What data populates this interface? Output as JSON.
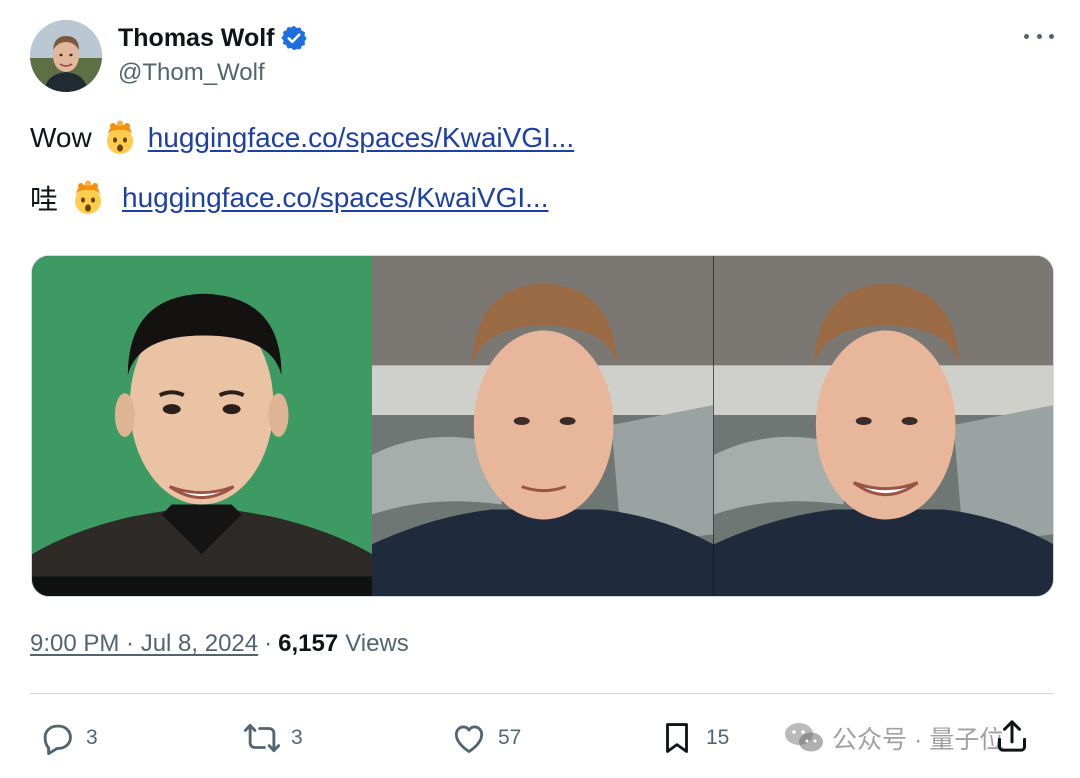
{
  "author": {
    "display_name": "Thomas Wolf",
    "handle": "@Thom_Wolf",
    "verified": true
  },
  "tweet": {
    "lines": [
      {
        "prefix": "Wow",
        "emoji": "exploding-head-icon",
        "link": "huggingface.co/spaces/KwaiVGI..."
      },
      {
        "prefix": "哇",
        "emoji": "exploding-head-icon",
        "link": "huggingface.co/spaces/KwaiVGI..."
      }
    ]
  },
  "media": {
    "panels": [
      {
        "name": "source-portrait",
        "background": "#3d9a63"
      },
      {
        "name": "driving-video-frame",
        "background": "#8a8782"
      },
      {
        "name": "result-frame",
        "background": "#8a8782"
      }
    ]
  },
  "meta": {
    "timestamp": "9:00 PM · Jul 8, 2024",
    "separator": "·",
    "views_count": "6,157",
    "views_label": "Views"
  },
  "actions": {
    "replies": "3",
    "reposts": "3",
    "likes": "57",
    "bookmarks": "15"
  },
  "watermark": {
    "text": "公众号 · 量子位"
  },
  "colors": {
    "link": "#1d3fa8",
    "secondary_text": "#536471",
    "verified": "#1d6ee0"
  }
}
